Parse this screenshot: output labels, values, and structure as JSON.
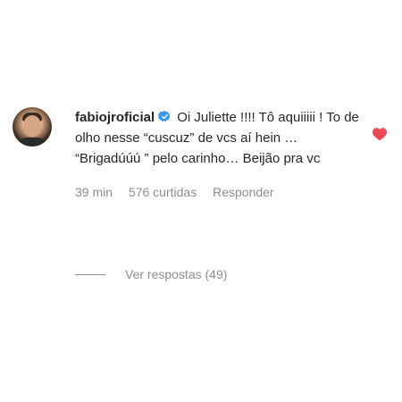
{
  "comment": {
    "username": "fabiojroficial",
    "verified": true,
    "text": "Oi Juliette !!!! Tô aquiiiii ! To de olho nesse “cuscuz” de vcs aí hein … “Brigadúúú ” pelo carinho… Beijão pra vc",
    "time": "39 min",
    "likes": "576 curtidas",
    "reply_label": "Responder",
    "liked": true,
    "heart_color": "#ed4956"
  },
  "replies": {
    "label": "Ver respostas (49)"
  },
  "colors": {
    "verified_badge": "#3897f0",
    "muted_text": "#8e8e8e"
  },
  "icons": {
    "verified": "verified-badge-icon",
    "like": "heart-icon"
  }
}
